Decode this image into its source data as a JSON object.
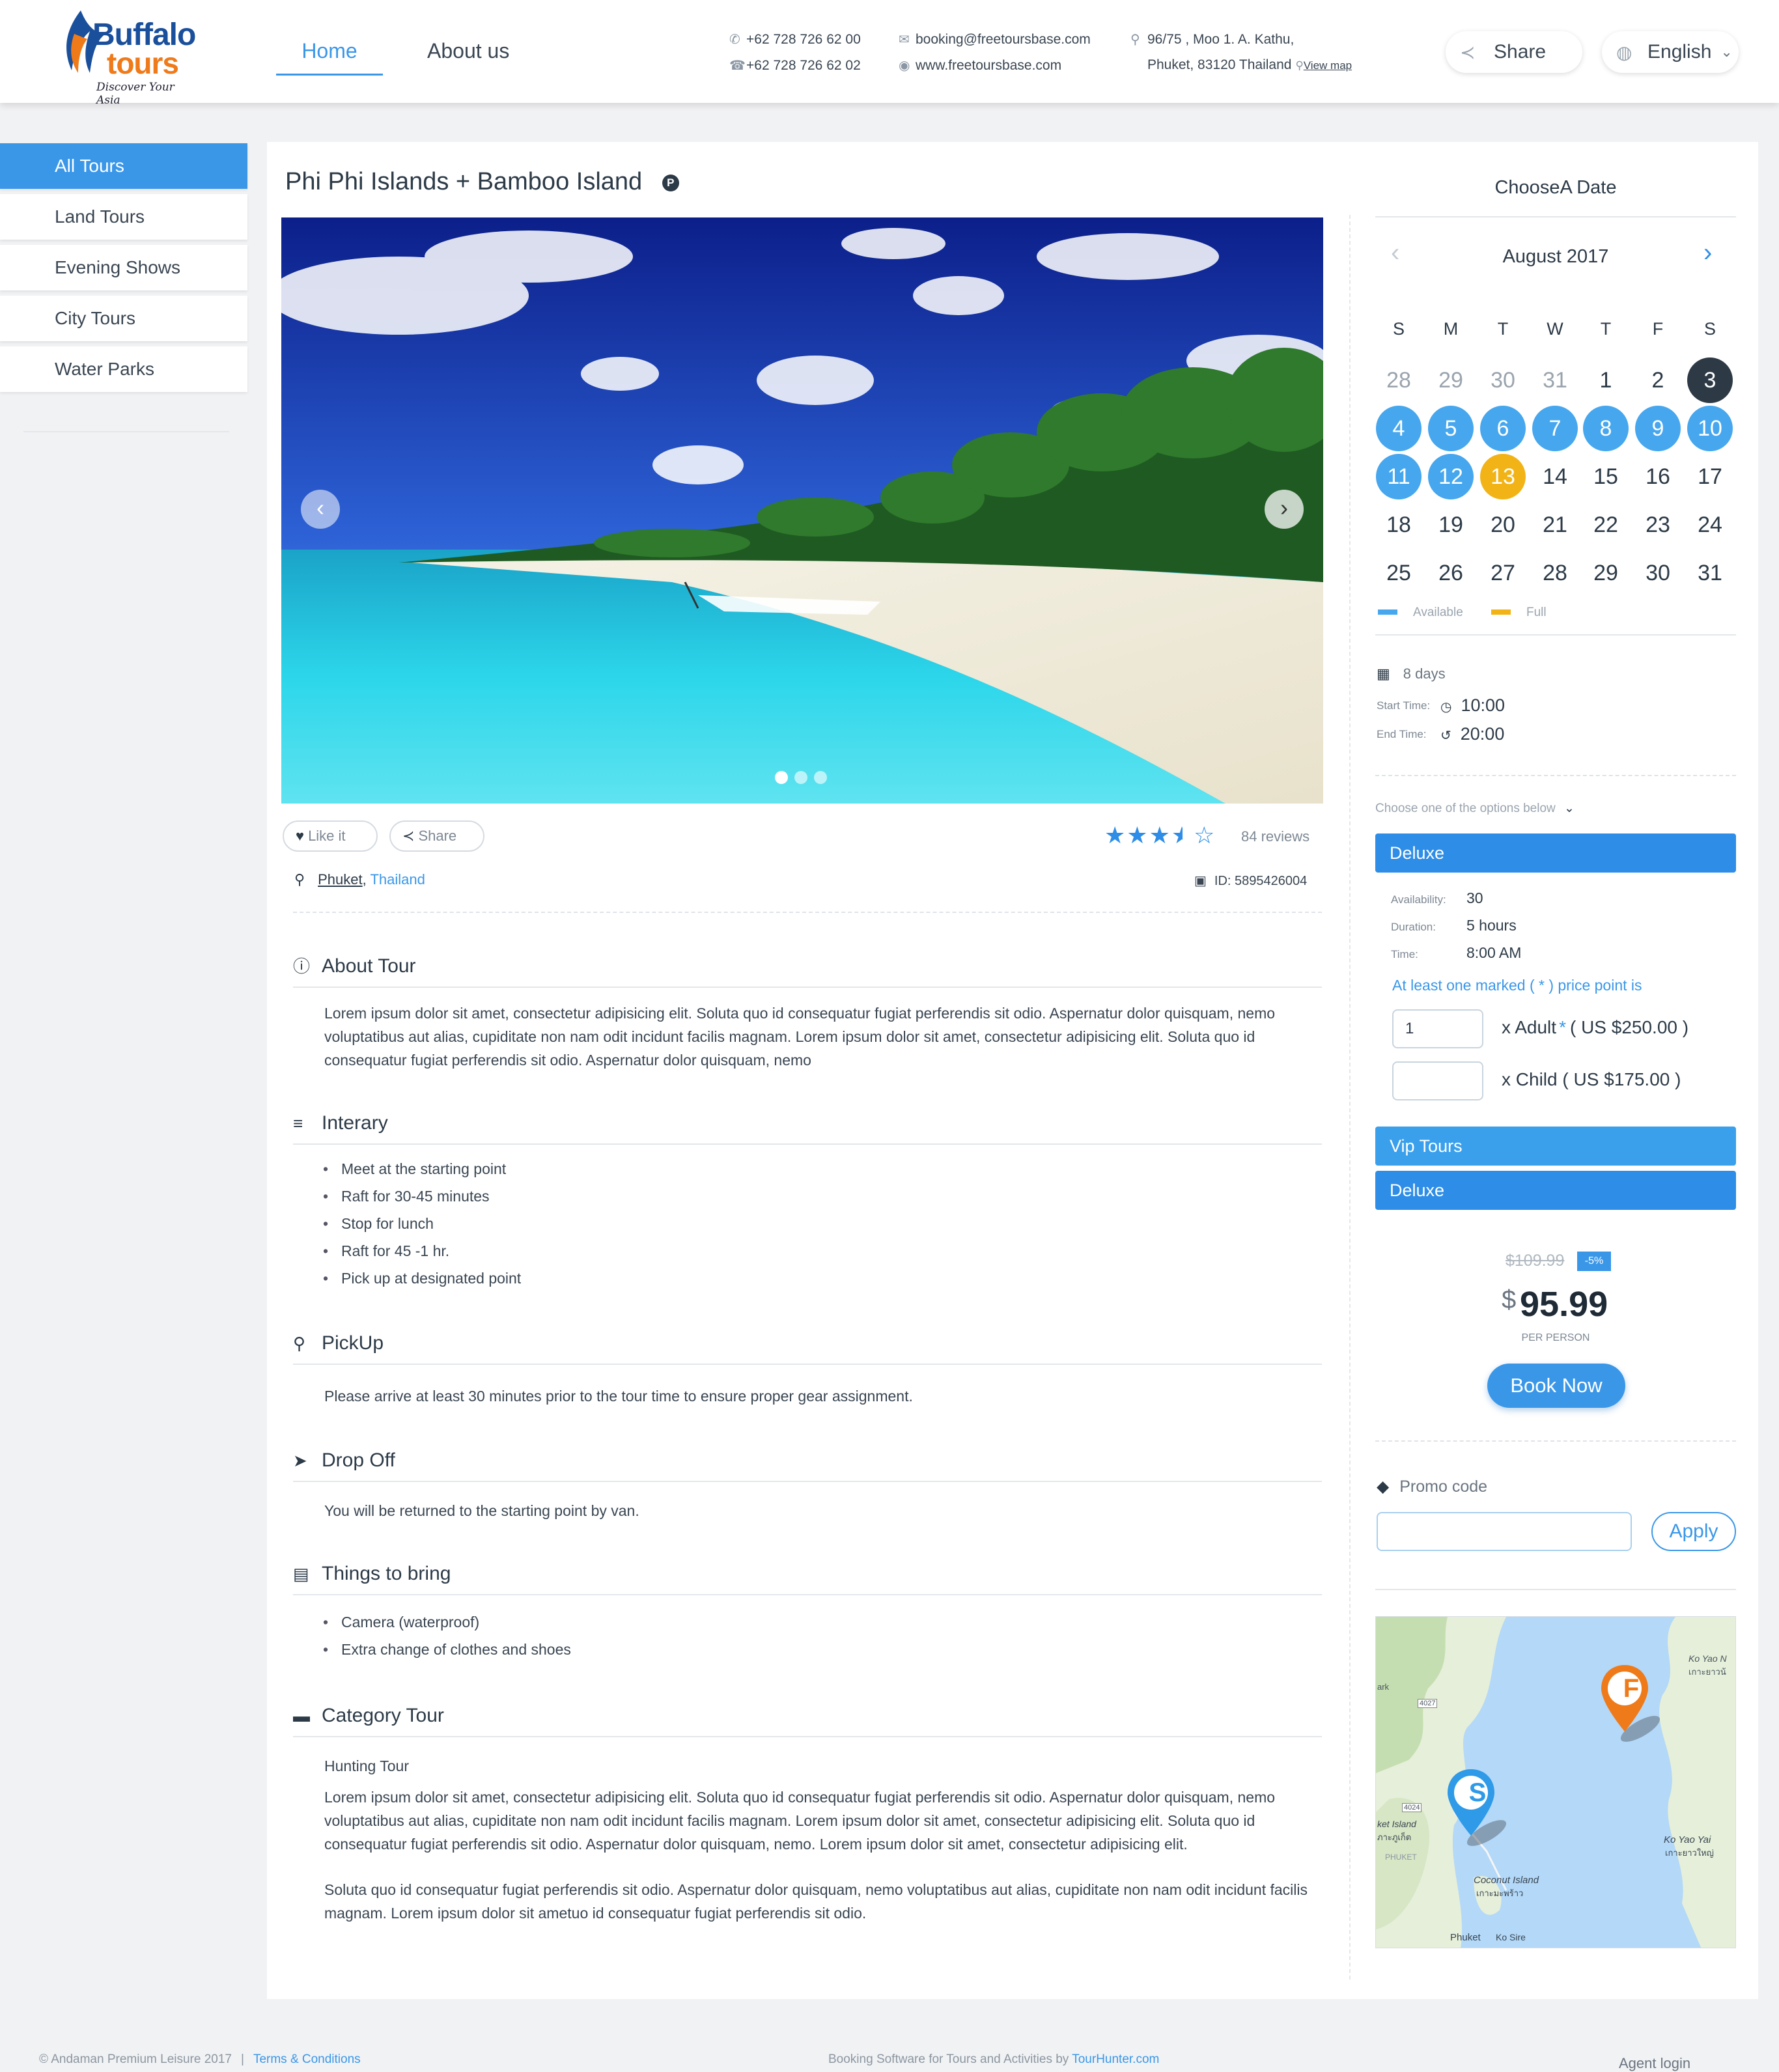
{
  "header": {
    "logo": {
      "line1": "Buffalo",
      "line2": "tours",
      "tagline": "Discover Your Asia"
    },
    "nav": [
      {
        "label": "Home",
        "active": true
      },
      {
        "label": "About us",
        "active": false
      }
    ],
    "phone1": "+62 728 726 62 00",
    "phone2": "+62 728 726 62 02",
    "email": "booking@freetoursbase.com",
    "website": "www.freetoursbase.com",
    "address1": "96/75 , Moo 1. A. Kathu,",
    "address2": "Phuket, 83120 Thailand",
    "view_map": "View map",
    "share_label": "Share",
    "language": "English"
  },
  "sidebar": {
    "items": [
      {
        "label": "All Tours",
        "active": true
      },
      {
        "label": "Land Tours",
        "active": false
      },
      {
        "label": "Evening Shows",
        "active": false
      },
      {
        "label": "City Tours",
        "active": false
      },
      {
        "label": "Water Parks",
        "active": false
      }
    ]
  },
  "tour": {
    "title": "Phi Phi Islands + Bamboo Island",
    "badge": "P",
    "like_label": "Like it",
    "share_label": "Share",
    "rating": 3.5,
    "reviews": "84 reviews",
    "location_city": "Phuket",
    "location_country": "Thailand",
    "id_label": "ID: 5895426004",
    "slides": 3,
    "active_slide": 1
  },
  "sections": {
    "about": {
      "title": "About Tour",
      "text": "Lorem ipsum dolor sit amet, consectetur adipisicing elit. Soluta quo id consequatur fugiat perferendis sit odio. Aspernatur dolor quisquam, nemo voluptatibus aut alias, cupiditate non nam odit incidunt facilis magnam. Lorem ipsum dolor sit amet, consectetur adipisicing elit. Soluta quo id consequatur fugiat perferendis sit odio. Aspernatur dolor quisquam, nemo"
    },
    "itinerary": {
      "title": "Interary",
      "items": [
        "Meet at the starting point",
        "Raft for 30-45 minutes",
        "Stop for lunch",
        "Raft for 45 -1 hr.",
        "Pick up at designated point"
      ]
    },
    "pickup": {
      "title": "PickUp",
      "text": "Please arrive at least 30 minutes prior to the tour time to ensure proper gear assignment."
    },
    "dropoff": {
      "title": "Drop Off",
      "text": "You will be returned to the starting point by van."
    },
    "bring": {
      "title": "Things to bring",
      "items": [
        "Camera (waterproof)",
        "Extra change of clothes and shoes"
      ]
    },
    "category": {
      "title": "Category Tour",
      "subtitle": "Hunting Tour",
      "text1": "Lorem ipsum dolor sit amet, consectetur adipisicing elit. Soluta quo id consequatur fugiat perferendis sit odio. Aspernatur dolor quisquam, nemo voluptatibus aut alias, cupiditate non nam odit incidunt facilis magnam. Lorem ipsum dolor sit amet, consectetur adipisicing elit. Soluta quo id consequatur fugiat perferendis sit odio. Aspernatur dolor quisquam, nemo. Lorem ipsum dolor sit amet, consectetur adipisicing elit.",
      "text2": "Soluta quo id consequatur fugiat perferendis sit odio. Aspernatur dolor quisquam, nemo voluptatibus aut alias, cupiditate non nam odit incidunt facilis magnam. Lorem ipsum dolor sit ametuo id consequatur fugiat perferendis sit odio."
    }
  },
  "booking": {
    "choose_date": "ChooseA Date",
    "month": "August 2017",
    "weekdays": [
      "S",
      "M",
      "T",
      "W",
      "T",
      "F",
      "S"
    ],
    "weeks": [
      [
        {
          "d": "28",
          "s": "other"
        },
        {
          "d": "29",
          "s": "other"
        },
        {
          "d": "30",
          "s": "other"
        },
        {
          "d": "31",
          "s": "other"
        },
        {
          "d": "1",
          "s": ""
        },
        {
          "d": "2",
          "s": ""
        },
        {
          "d": "3",
          "s": "sel"
        }
      ],
      [
        {
          "d": "4",
          "s": "avail"
        },
        {
          "d": "5",
          "s": "avail"
        },
        {
          "d": "6",
          "s": "avail"
        },
        {
          "d": "7",
          "s": "avail"
        },
        {
          "d": "8",
          "s": "avail"
        },
        {
          "d": "9",
          "s": "avail"
        },
        {
          "d": "10",
          "s": "avail"
        }
      ],
      [
        {
          "d": "11",
          "s": "avail"
        },
        {
          "d": "12",
          "s": "avail"
        },
        {
          "d": "13",
          "s": "full"
        },
        {
          "d": "14",
          "s": ""
        },
        {
          "d": "15",
          "s": ""
        },
        {
          "d": "16",
          "s": ""
        },
        {
          "d": "17",
          "s": ""
        }
      ],
      [
        {
          "d": "18",
          "s": ""
        },
        {
          "d": "19",
          "s": ""
        },
        {
          "d": "20",
          "s": ""
        },
        {
          "d": "21",
          "s": ""
        },
        {
          "d": "22",
          "s": ""
        },
        {
          "d": "23",
          "s": ""
        },
        {
          "d": "24",
          "s": ""
        }
      ],
      [
        {
          "d": "25",
          "s": ""
        },
        {
          "d": "26",
          "s": ""
        },
        {
          "d": "27",
          "s": ""
        },
        {
          "d": "28",
          "s": ""
        },
        {
          "d": "29",
          "s": ""
        },
        {
          "d": "30",
          "s": ""
        },
        {
          "d": "31",
          "s": ""
        }
      ]
    ],
    "legend_available": "Available",
    "legend_full": "Full",
    "days": "8 days",
    "start_label": "Start Time:",
    "start_time": "10:00",
    "end_label": "End Time:",
    "end_time": "20:00",
    "choose_option": "Choose one of the options below",
    "option1": "Deluxe",
    "availability_label": "Availability:",
    "availability": "30",
    "duration_label": "Duration:",
    "duration": "5 hours",
    "time_label": "Time:",
    "time": "8:00 AM",
    "price_note": "At least one marked ( * ) price point is",
    "adult_qty": "1",
    "adult_label": "x Adult",
    "adult_star": "*",
    "adult_price": "( US $250.00 )",
    "child_qty": "",
    "child_label": "x Child ( US $175.00 )",
    "option2": "Vip Tours",
    "option3": "Deluxe",
    "old_price": "$109.99",
    "discount": "-5%",
    "currency": "$",
    "price": "95.99",
    "per_person": "PER PERSON",
    "book_now": "Book Now",
    "promo_label": "Promo code",
    "promo_value": "",
    "apply": "Apply"
  },
  "map": {
    "labels": [
      "Ko Yao N",
      "เกาะยาวน้",
      "ark",
      "4027",
      "4024",
      "ket Island",
      "ภาะภูเก็ต",
      "PHUKET",
      "Coconut Island",
      "เกาะมะพร้าว",
      "Ko Yao Yai",
      "เกาะยาวใหญ่",
      "Phuket",
      "Ko Sire"
    ],
    "pin_start": "S",
    "pin_finish": "F"
  },
  "footer": {
    "copyright": "© Andaman Premium Leisure 2017",
    "separator": "|",
    "terms": "Terms & Conditions",
    "powered": "Booking Software for Tours and Activities by",
    "powered_link": "TourHunter.com",
    "agent": "Agent login"
  },
  "colors": {
    "accent": "#3a97e8",
    "available": "#46a7ee",
    "full": "#f2b316",
    "selected": "#2d3a46",
    "option_bar": "#2e8de6"
  }
}
